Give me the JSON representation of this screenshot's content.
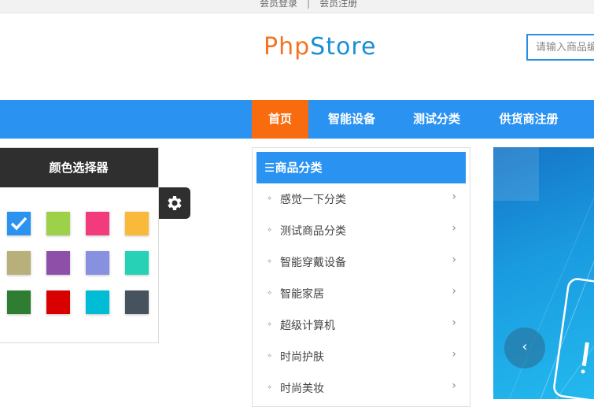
{
  "topbar": {
    "login": "会员登录",
    "separator": "|",
    "register": "会员注册"
  },
  "header": {
    "logo_php": "Php",
    "logo_store": "Store",
    "search_placeholder": "请输入商品编"
  },
  "nav": {
    "items": [
      "首页",
      "智能设备",
      "测试分类",
      "供货商注册"
    ],
    "active": "首页"
  },
  "color_picker": {
    "title": "颜色选择器",
    "selected": "#2a93f2",
    "swatches": [
      "#2a93f2",
      "#9ed14a",
      "#f23a7c",
      "#f9b93a",
      "#b8b07a",
      "#8d4fa8",
      "#8891e0",
      "#27d1b6",
      "#2e7d32",
      "#d90000",
      "#00bcd4",
      "#46525e"
    ]
  },
  "categories": {
    "title": "商品分类",
    "items": [
      "感觉一下分类",
      "测试商品分类",
      "智能穿戴设备",
      "智能家居",
      "超级计算机",
      "时尚护肤",
      "时尚美妆"
    ]
  },
  "banner": {
    "prev_label": "‹"
  },
  "colors": {
    "accent": "#2a93f2",
    "active_nav": "#f96b0f",
    "dark_panel": "#2f2f2f"
  }
}
